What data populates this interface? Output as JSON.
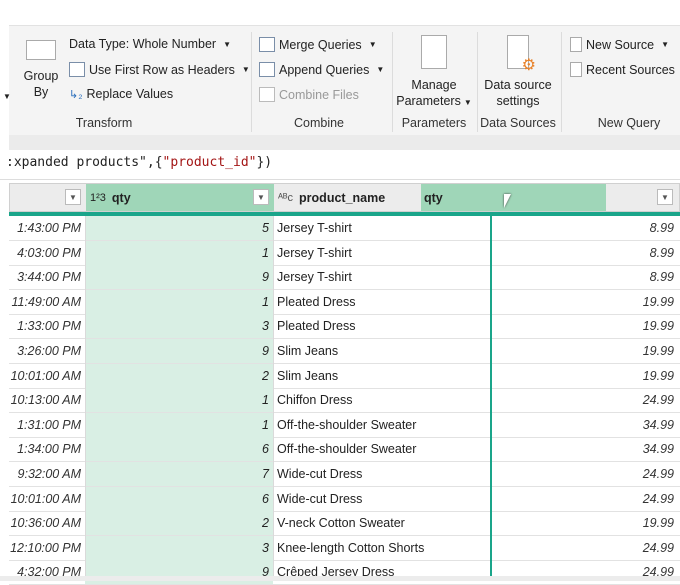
{
  "ribbon": {
    "group_by": [
      "Group",
      "By"
    ],
    "data_type": "Data Type: Whole Number",
    "use_first_row": "Use First Row as Headers",
    "replace_values": "Replace Values",
    "transform_label": "Transform",
    "merge_queries": "Merge Queries",
    "append_queries": "Append Queries",
    "combine_files": "Combine Files",
    "combine_label": "Combine",
    "manage_parameters": [
      "Manage",
      "Parameters"
    ],
    "parameters_label": "Parameters",
    "data_source_settings": [
      "Data source",
      "settings"
    ],
    "data_sources_label": "Data Sources",
    "new_source": "New Source",
    "recent_sources": "Recent Sources",
    "new_query_label": "New Query"
  },
  "formula": {
    "prefix": ":xpanded products\",{",
    "string": "\"product_id\"",
    "suffix": "})"
  },
  "columns": {
    "qty_type": "1²3",
    "qty": "qty",
    "name_type": "ᴬᴮc",
    "product_name": "product_name",
    "drag_label": "qty"
  },
  "rows": [
    {
      "time": "1:43:00 PM",
      "qty": "5",
      "name": "Jersey T-shirt",
      "price": "8.99"
    },
    {
      "time": "4:03:00 PM",
      "qty": "1",
      "name": "Jersey T-shirt",
      "price": "8.99"
    },
    {
      "time": "3:44:00 PM",
      "qty": "9",
      "name": "Jersey T-shirt",
      "price": "8.99"
    },
    {
      "time": "11:49:00 AM",
      "qty": "1",
      "name": "Pleated Dress",
      "price": "19.99"
    },
    {
      "time": "1:33:00 PM",
      "qty": "3",
      "name": "Pleated Dress",
      "price": "19.99"
    },
    {
      "time": "3:26:00 PM",
      "qty": "9",
      "name": "Slim Jeans",
      "price": "19.99"
    },
    {
      "time": "10:01:00 AM",
      "qty": "2",
      "name": "Slim Jeans",
      "price": "19.99"
    },
    {
      "time": "10:13:00 AM",
      "qty": "1",
      "name": "Chiffon Dress",
      "price": "24.99"
    },
    {
      "time": "1:31:00 PM",
      "qty": "1",
      "name": "Off-the-shoulder Sweater",
      "price": "34.99"
    },
    {
      "time": "1:34:00 PM",
      "qty": "6",
      "name": "Off-the-shoulder Sweater",
      "price": "34.99"
    },
    {
      "time": "9:32:00 AM",
      "qty": "7",
      "name": "Wide-cut Dress",
      "price": "24.99"
    },
    {
      "time": "10:01:00 AM",
      "qty": "6",
      "name": "Wide-cut Dress",
      "price": "24.99"
    },
    {
      "time": "10:36:00 AM",
      "qty": "2",
      "name": "V-neck Cotton Sweater",
      "price": "19.99"
    },
    {
      "time": "12:10:00 PM",
      "qty": "3",
      "name": "Knee-length Cotton Shorts",
      "price": "24.99"
    },
    {
      "time": "4:32:00 PM",
      "qty": "9",
      "name": "Crêped Jersey Dress",
      "price": "24.99"
    }
  ]
}
